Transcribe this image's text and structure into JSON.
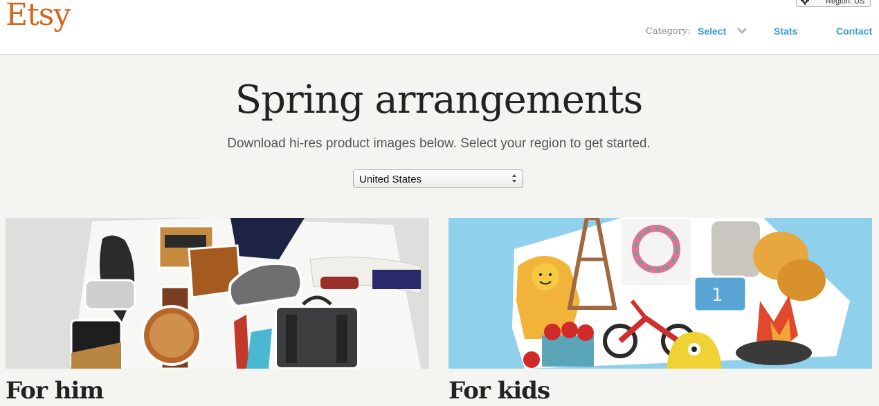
{
  "header": {
    "logo": "Etsy",
    "region_button": "Region: US",
    "nav": {
      "category_label": "Category:",
      "select_label": "Select",
      "stats_label": "Stats",
      "contact_label": "Contact"
    }
  },
  "hero": {
    "title": "Spring arrangements",
    "subtitle": "Download hi-res product images below. Select your region to get started.",
    "region_select_value": "United States"
  },
  "collections": [
    {
      "title": "For him",
      "image": "mens-products-collage"
    },
    {
      "title": "For kids",
      "image": "kids-products-collage"
    }
  ],
  "icons": [
    "gear-icon",
    "chevron-down-icon",
    "select-arrows-icon"
  ],
  "colors": {
    "brand": "#d5641c",
    "link": "#3d9bd3",
    "kids_bg": "#8fd0ec",
    "him_bg": "#dededc"
  }
}
